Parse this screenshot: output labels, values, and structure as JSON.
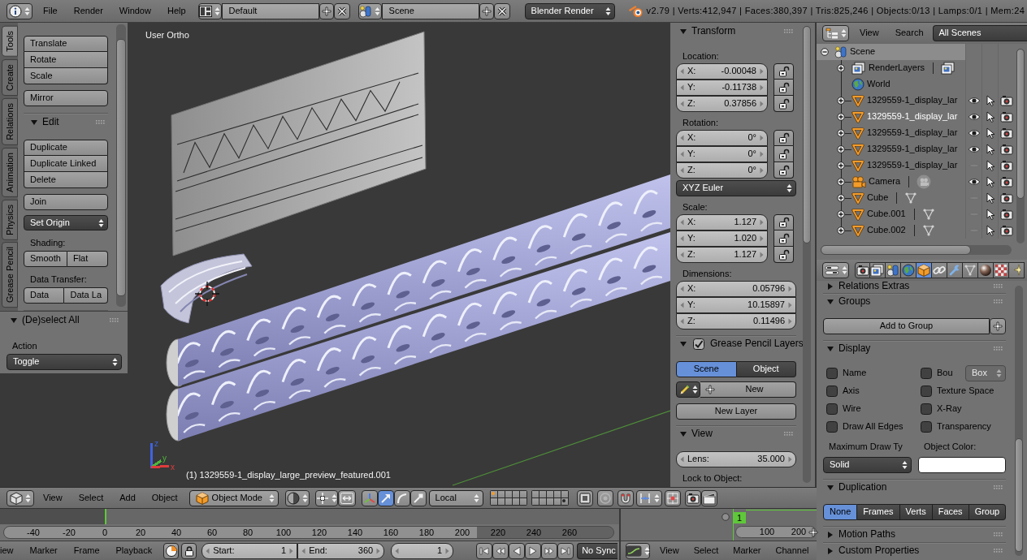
{
  "top_bar": {
    "menus": [
      "File",
      "Render",
      "Window",
      "Help"
    ],
    "screen_layout": "Default",
    "scene": "Scene",
    "render_engine": "Blender Render",
    "stats": "v2.79 | Verts:412,947 | Faces:380,397 | Tris:825,246 | Objects:0/13 | Lamps:0/1 | Mem:24"
  },
  "tool_shelf": {
    "tabs": [
      {
        "label": "Tools",
        "selected": true
      },
      {
        "label": "Create",
        "selected": false
      },
      {
        "label": "Relations",
        "selected": false
      },
      {
        "label": "Animation",
        "selected": false
      },
      {
        "label": "Physics",
        "selected": false
      },
      {
        "label": "Grease Pencil",
        "selected": false
      }
    ],
    "items": [
      {
        "kind": "column",
        "buttons": [
          "Translate",
          "Rotate",
          "Scale"
        ]
      },
      {
        "kind": "column",
        "buttons": [
          "Mirror"
        ]
      },
      {
        "kind": "header",
        "title": "Edit",
        "expanded": true
      },
      {
        "kind": "column",
        "buttons": [
          "Duplicate",
          "Duplicate Linked",
          "Delete"
        ]
      },
      {
        "kind": "column",
        "buttons": [
          "Join"
        ]
      },
      {
        "kind": "dropdown",
        "value": "Set Origin"
      },
      {
        "kind": "label",
        "text": "Shading:"
      },
      {
        "kind": "row",
        "buttons": [
          "Smooth",
          "Flat"
        ]
      },
      {
        "kind": "label",
        "text": "Data Transfer:"
      },
      {
        "kind": "row",
        "buttons": [
          "Data",
          "Data La"
        ]
      }
    ]
  },
  "operator_panel": {
    "title": "(De)select All",
    "expanded": true,
    "label": "Action",
    "value": "Toggle"
  },
  "viewport": {
    "view_name": "User Ortho",
    "object_info": "(1) 1329559-1_display_large_preview_featured.001",
    "axes": [
      {
        "label": "z",
        "color": "#3f63e0"
      },
      {
        "label": "y",
        "color": "#4fb83a"
      },
      {
        "label": "x",
        "color": "#e03c3c"
      }
    ]
  },
  "n_panel": {
    "items": [
      {
        "kind": "header",
        "title": "Transform",
        "expanded": true
      },
      {
        "kind": "label",
        "text": "Location:"
      },
      {
        "kind": "vector",
        "fields": [
          {
            "name": "X:",
            "value": "-0.00048",
            "locked": false
          },
          {
            "name": "Y:",
            "value": "-0.11738",
            "locked": false
          },
          {
            "name": "Z:",
            "value": "0.37856",
            "locked": false
          }
        ]
      },
      {
        "kind": "label",
        "text": "Rotation:"
      },
      {
        "kind": "vector",
        "fields": [
          {
            "name": "X:",
            "value": "0°",
            "locked": false
          },
          {
            "name": "Y:",
            "value": "0°",
            "locked": false
          },
          {
            "name": "Z:",
            "value": "0°",
            "locked": false
          }
        ]
      },
      {
        "kind": "dropdown",
        "value": "XYZ Euler"
      },
      {
        "kind": "label",
        "text": "Scale:"
      },
      {
        "kind": "vector",
        "fields": [
          {
            "name": "X:",
            "value": "1.127",
            "locked": false
          },
          {
            "name": "Y:",
            "value": "1.020",
            "locked": false
          },
          {
            "name": "Z:",
            "value": "1.127",
            "locked": false
          }
        ]
      },
      {
        "kind": "label",
        "text": "Dimensions:"
      },
      {
        "kind": "vector",
        "fields": [
          {
            "name": "X:",
            "value": "0.05796"
          },
          {
            "name": "Y:",
            "value": "10.15897"
          },
          {
            "name": "Z:",
            "value": "0.11496"
          }
        ]
      },
      {
        "kind": "checkbox_header",
        "title": "Grease Pencil Layers",
        "expanded": true,
        "checked": true
      },
      {
        "kind": "toggle_row",
        "options": [
          {
            "label": "Scene",
            "selected": true
          },
          {
            "label": "Object",
            "selected": false
          }
        ]
      },
      {
        "kind": "new_row",
        "label": "New"
      },
      {
        "kind": "button",
        "label": "New Layer"
      },
      {
        "kind": "header",
        "title": "View",
        "expanded": true
      },
      {
        "kind": "number",
        "name": "Lens:",
        "value": "35.000"
      },
      {
        "kind": "label",
        "text": "Lock to Object:"
      }
    ]
  },
  "outliner": {
    "menus": [
      "View",
      "Search"
    ],
    "display_mode": "All Scenes",
    "tree": [
      {
        "label": "Scene",
        "kind": "scene",
        "expanded": true,
        "selected": true,
        "children": [
          {
            "label": "RenderLayers",
            "kind": "render_layers",
            "expanded": false,
            "selected": false,
            "data_icon": true
          },
          {
            "label": "World",
            "kind": "world",
            "selected": false,
            "data_icon": false
          },
          {
            "label": "1329559-1_display_lar",
            "kind": "mesh",
            "expanded": false,
            "selected": false,
            "active": false,
            "visible": true,
            "selectable": true,
            "renderable": true,
            "data_icon": false
          },
          {
            "label": "1329559-1_display_lar",
            "kind": "mesh",
            "expanded": false,
            "selected": false,
            "active": true,
            "visible": true,
            "selectable": true,
            "renderable": true,
            "data_icon": false
          },
          {
            "label": "1329559-1_display_lar",
            "kind": "mesh",
            "expanded": false,
            "selected": false,
            "active": false,
            "visible": true,
            "selectable": true,
            "renderable": true,
            "data_icon": false
          },
          {
            "label": "1329559-1_display_lar",
            "kind": "mesh",
            "expanded": false,
            "selected": false,
            "active": false,
            "visible": true,
            "selectable": true,
            "renderable": true,
            "data_icon": false
          },
          {
            "label": "1329559-1_display_lar",
            "kind": "mesh",
            "expanded": false,
            "selected": false,
            "active": false,
            "visible": false,
            "selectable": true,
            "renderable": true,
            "data_icon": false
          },
          {
            "label": "Camera",
            "kind": "camera",
            "expanded": false,
            "selected": false,
            "active": false,
            "visible": true,
            "selectable": true,
            "renderable": true,
            "data_icon": true
          },
          {
            "label": "Cube",
            "kind": "mesh",
            "expanded": false,
            "selected": false,
            "active": false,
            "visible": false,
            "selectable": true,
            "renderable": true,
            "data_icon": true
          },
          {
            "label": "Cube.001",
            "kind": "mesh",
            "expanded": false,
            "selected": false,
            "active": false,
            "visible": false,
            "selectable": true,
            "renderable": true,
            "data_icon": true
          },
          {
            "label": "Cube.002",
            "kind": "mesh",
            "expanded": false,
            "selected": false,
            "active": false,
            "visible": false,
            "selectable": true,
            "renderable": true,
            "data_icon": true
          }
        ]
      }
    ]
  },
  "properties": {
    "tabs": [
      {
        "kind": "render",
        "selected": false
      },
      {
        "kind": "render_layers",
        "selected": false
      },
      {
        "kind": "scene",
        "selected": false
      },
      {
        "kind": "world",
        "selected": false
      },
      {
        "kind": "object",
        "selected": true
      },
      {
        "kind": "constraints",
        "selected": false
      },
      {
        "kind": "modifiers",
        "selected": false
      },
      {
        "kind": "data",
        "selected": false
      },
      {
        "kind": "material",
        "selected": false
      },
      {
        "kind": "texture",
        "selected": false
      },
      {
        "kind": "particles",
        "selected": false
      }
    ],
    "panels": [
      {
        "title": "Relations Extras",
        "expanded": false
      },
      {
        "title": "Groups",
        "expanded": true,
        "items": [
          {
            "kind": "add_button",
            "label": "Add to Group"
          }
        ]
      },
      {
        "title": "Display",
        "expanded": true,
        "items": [
          {
            "kind": "checkbox_columns",
            "columns": [
              [
                {
                  "label": "Name",
                  "checked": false
                },
                {
                  "label": "Axis",
                  "checked": false
                },
                {
                  "label": "Wire",
                  "checked": false
                },
                {
                  "label": "Draw All Edges",
                  "checked": false
                }
              ],
              [
                {
                  "label": "Bou",
                  "checked": false,
                  "option": {
                    "value": "Box",
                    "disabled": true
                  }
                },
                {
                  "label": "Texture Space",
                  "checked": false
                },
                {
                  "label": "X-Ray",
                  "checked": false
                },
                {
                  "label": "Transparency",
                  "checked": false
                }
              ]
            ]
          },
          {
            "kind": "draw_type",
            "label": "Maximum Draw Ty",
            "value": "Solid",
            "color_label": "Object Color:",
            "color": "#ffffff"
          }
        ]
      },
      {
        "title": "Duplication",
        "expanded": true,
        "items": [
          {
            "kind": "toggle_row",
            "options": [
              {
                "label": "None",
                "selected": true
              },
              {
                "label": "Frames",
                "selected": false
              },
              {
                "label": "Verts",
                "selected": false
              },
              {
                "label": "Faces",
                "selected": false
              },
              {
                "label": "Group",
                "selected": false
              }
            ]
          }
        ]
      },
      {
        "title": "Motion Paths",
        "expanded": false
      },
      {
        "title": "Custom Properties",
        "expanded": false
      }
    ]
  },
  "view3d_header": {
    "menus": [
      "View",
      "Select",
      "Add",
      "Object"
    ],
    "mode": "Object Mode",
    "orientation": "Local",
    "manipulators": [
      {
        "kind": "translate",
        "selected": true
      },
      {
        "kind": "rotate",
        "selected": false
      },
      {
        "kind": "scale",
        "selected": false
      }
    ],
    "layers": [
      {
        "kind": "active"
      },
      {
        "kind": "empty"
      },
      {
        "kind": "empty"
      },
      {
        "kind": "empty"
      },
      {
        "kind": "empty"
      },
      {
        "kind": "empty"
      },
      {
        "kind": "empty"
      },
      {
        "kind": "empty"
      },
      {
        "kind": "empty"
      },
      {
        "kind": "empty"
      },
      {
        "kind": "empty"
      },
      {
        "kind": "empty"
      },
      {
        "kind": "empty"
      },
      {
        "kind": "empty"
      },
      {
        "kind": "empty"
      },
      {
        "kind": "empty"
      },
      {
        "kind": "empty"
      },
      {
        "kind": "empty"
      },
      {
        "kind": "empty"
      },
      {
        "kind": "objects"
      }
    ]
  },
  "timeline": {
    "ruler": [
      "-40",
      "-20",
      "0",
      "20",
      "40",
      "60",
      "80",
      "100",
      "120",
      "140",
      "160",
      "180",
      "200",
      "220",
      "240",
      "260"
    ],
    "menus": [
      "iew",
      "Marker",
      "Frame",
      "Playback"
    ],
    "start": {
      "label": "Start:",
      "value": "1"
    },
    "end": {
      "label": "End:",
      "value": "360"
    },
    "frame": "1",
    "sync": "No Sync"
  },
  "graph_editor": {
    "frame": "1",
    "ruler": [
      "100",
      "200"
    ],
    "menus": [
      "View",
      "Select",
      "Marker",
      "Channel"
    ]
  }
}
